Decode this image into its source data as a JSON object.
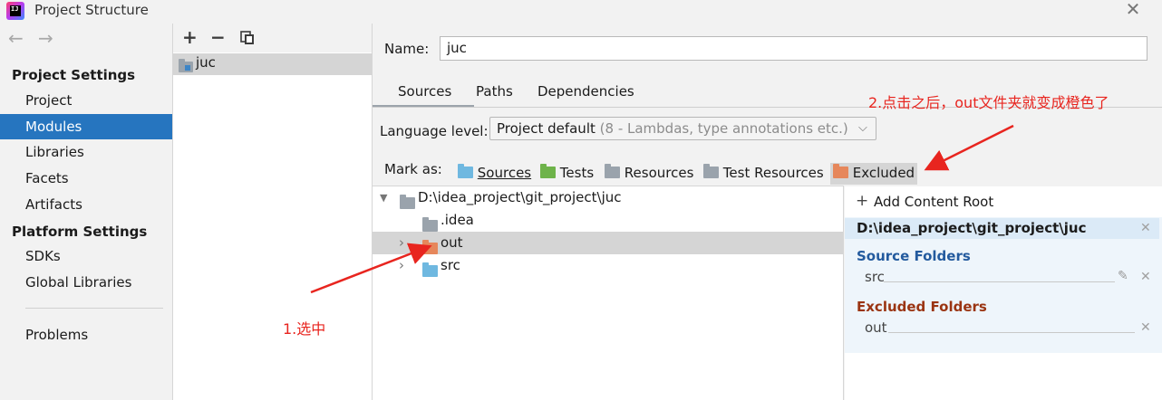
{
  "window": {
    "title": "Project Structure",
    "logo_text": "IJ"
  },
  "nav": {
    "back": "←",
    "forward": "→",
    "project_settings_heading": "Project Settings",
    "platform_settings_heading": "Platform Settings",
    "items": [
      "Project",
      "Modules",
      "Libraries",
      "Facets",
      "Artifacts"
    ],
    "platform_items": [
      "SDKs",
      "Global Libraries"
    ],
    "problems": "Problems",
    "selected": "Modules"
  },
  "modules": {
    "toolbar": [
      "+",
      "−"
    ],
    "items": [
      "juc"
    ]
  },
  "main": {
    "name_label": "Name:",
    "name_value": "juc",
    "tabs": [
      "Sources",
      "Paths",
      "Dependencies"
    ],
    "active_tab": "Sources",
    "language_level_label": "Language level:",
    "language_level_value": "Project default",
    "language_level_hint": "(8 - Lambdas, type annotations etc.)",
    "mark_as_label": "Mark as:",
    "mark_as": [
      "Sources",
      "Tests",
      "Resources",
      "Test Resources",
      "Excluded"
    ]
  },
  "tree": {
    "root": "D:\\idea_project\\git_project\\juc",
    "children": [
      ".idea",
      "out",
      "src"
    ],
    "selected": "out"
  },
  "content_root": {
    "add_label": "Add Content Root",
    "path": "D:\\idea_project\\git_project\\juc",
    "source_folders_title": "Source Folders",
    "source_folders": [
      "src"
    ],
    "excluded_folders_title": "Excluded Folders",
    "excluded_folders": [
      "out"
    ]
  },
  "annotations": {
    "step1": "1.选中",
    "step2": "2.点击之后，out文件夹就变成橙色了"
  },
  "colors": {
    "accent": "#2675bf",
    "annotation": "#e8251f",
    "sources_folder": "#6fb8e0",
    "tests_folder": "#6eb34a",
    "resources_folder": "#9aa3ac",
    "excluded_folder": "#e6875b",
    "source_title": "#235a9e",
    "excluded_title": "#9a3412"
  }
}
